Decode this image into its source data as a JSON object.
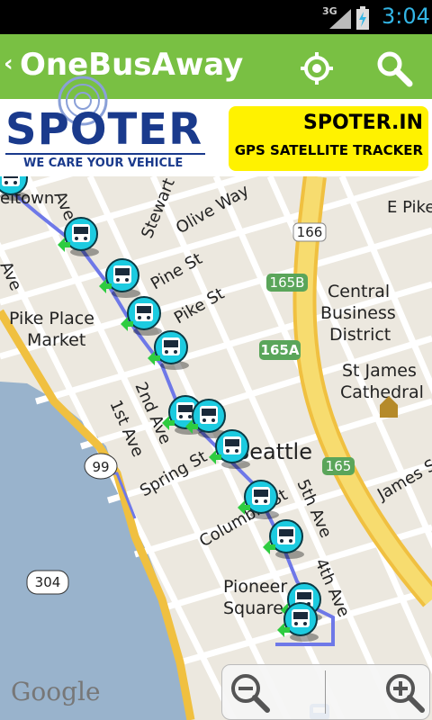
{
  "status": {
    "network": "3G",
    "time": "3:04"
  },
  "app_bar": {
    "back_glyph": "‹",
    "title": "OneBusAway",
    "locate_icon": "crosshair-icon",
    "search_icon": "search-icon"
  },
  "ad": {
    "brand": "SPOTER",
    "tagline": "WE CARE YOUR VEHICLE",
    "headline": "SPOTER.IN",
    "subline": "GPS SATELLITE TRACKER"
  },
  "map": {
    "streets": [
      "Olive Way",
      "Stewart St",
      "Pine St",
      "Pike St",
      "2nd Ave",
      "1st Ave",
      "Spring St",
      "Columbia St",
      "5th Ave",
      "4th Ave",
      "James St",
      "E Pike",
      "Ave",
      "Ave",
      "eltown"
    ],
    "places": [
      "Pike Place",
      "Market",
      "Central",
      "Business",
      "District",
      "St James",
      "Cathedral",
      "Pioneer",
      "Square",
      "Seattle"
    ],
    "shields": [
      "166",
      "165B",
      "165A",
      "165",
      "99",
      "304"
    ],
    "attribution": "Google"
  },
  "zoom": {
    "out_icon": "zoom-out-icon",
    "in_icon": "zoom-in-icon"
  },
  "colors": {
    "action_bar": "#79c043",
    "status_time": "#33b5e5",
    "route": "#6e78e8",
    "bus": "#1ccbe0"
  }
}
